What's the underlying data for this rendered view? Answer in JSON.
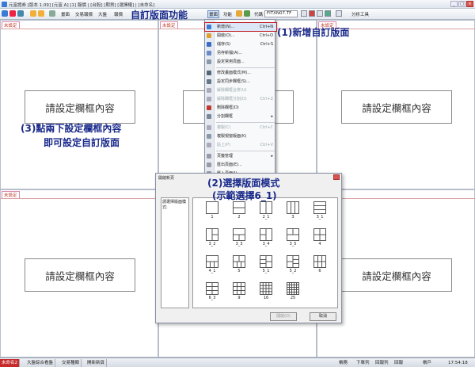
{
  "window": {
    "title": "元富證券 [版本 1.09] [元富 A] [1] 報價 | [台股] [期貨] [選擇權] | [未命名]",
    "min": "_",
    "max": "□",
    "close": "×"
  },
  "toolbar": {
    "items": [
      "畫面",
      "交易報價",
      "大盤",
      "報價",
      "功能"
    ],
    "custom_menu": "畫面",
    "func_menu": "功能",
    "search_label": "代碼",
    "search_value": "FITXN07.TF",
    "tools_label": "分析工具"
  },
  "callouts": {
    "feature": "自訂版面功能",
    "step1": "(1)新增自訂版面",
    "step2_line1": "(2)選擇版面模式",
    "step2_line2": "(示範選擇6_1)",
    "step3_line1": "(3)點兩下設定欄框內容",
    "step3_line2": "即可設定自訂版面"
  },
  "panes": {
    "tag": "未設定",
    "placeholder": "請設定欄框內容"
  },
  "menu": {
    "items": [
      {
        "label": "新增(N)...",
        "shortcut": "Ctrl+N",
        "disabled": false,
        "hl": true,
        "color": "#3a7bd5"
      },
      {
        "label": "開啟(O)...",
        "shortcut": "Ctrl+O",
        "disabled": false,
        "color": "#e0a030"
      },
      {
        "label": "儲存(S)",
        "shortcut": "Ctrl+S",
        "disabled": false,
        "color": "#3a6bc5"
      },
      {
        "label": "另存新檔(A)...",
        "shortcut": "",
        "disabled": false,
        "color": "#6a8acb"
      },
      {
        "label": "設定常用頁面...",
        "shortcut": "",
        "disabled": false,
        "color": "#8899aa"
      },
      {
        "label": "修改畫面模式(M)...",
        "shortcut": "",
        "disabled": false,
        "color": "#556677"
      },
      {
        "label": "設定同步欄框(S)...",
        "shortcut": "",
        "disabled": false,
        "color": "#667788"
      },
      {
        "label": "解除欄框合併(U)",
        "shortcut": "",
        "disabled": true,
        "color": "#aab"
      },
      {
        "label": "解除欄框分割(D)",
        "shortcut": "Ctrl+Z",
        "disabled": true,
        "color": "#aab"
      },
      {
        "label": "刪除欄框(D)",
        "shortcut": "",
        "disabled": false,
        "color": "#c0392b"
      },
      {
        "label": "分割欄框",
        "shortcut": "▸",
        "disabled": false,
        "color": "#778899"
      },
      {
        "label": "複製(C)",
        "shortcut": "Ctrl+C",
        "disabled": true,
        "color": "#aab"
      },
      {
        "label": "複製視窗版面(K)",
        "shortcut": "",
        "disabled": false,
        "color": "#8899aa"
      },
      {
        "label": "貼上(P)",
        "shortcut": "Ctrl+V",
        "disabled": true,
        "color": "#aab"
      },
      {
        "label": "頁籤管理",
        "shortcut": "▸",
        "disabled": false,
        "color": "#99a"
      },
      {
        "label": "匯出頁面(E)...",
        "shortcut": "",
        "disabled": false,
        "color": "#99a"
      },
      {
        "label": "匯入頁面(I)...",
        "shortcut": "",
        "disabled": false,
        "color": "#99a"
      }
    ]
  },
  "dialog": {
    "title": "開啟新頁",
    "list_label": "請選擇版面模式:",
    "layouts": [
      "1",
      "2",
      "2_1",
      "3",
      "3_1",
      "3_2",
      "3_3",
      "3_4",
      "3_5",
      "4",
      "4_1",
      "5",
      "5_1",
      "5_2",
      "6",
      "6_3",
      "9",
      "16",
      "25"
    ],
    "ok": "開啟(O)",
    "cancel": "取消"
  },
  "statusbar": {
    "tabs": [
      "未命名2",
      "大盤綜合看盤",
      "交易種類",
      "開新新頁"
    ],
    "right": [
      "帳務",
      "下單列",
      "回報列",
      "回報",
      "帳戶",
      "17:54:18"
    ]
  },
  "colors": {
    "accent": "#c82a2a",
    "callout": "#1a2a8c"
  }
}
